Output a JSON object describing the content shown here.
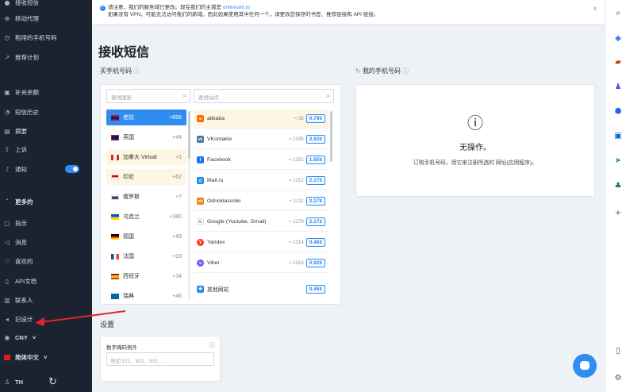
{
  "sidebar": {
    "items": [
      {
        "icon": "user-icon",
        "label": "接收短信"
      },
      {
        "icon": "proxy-icon",
        "label": "移动代理"
      },
      {
        "icon": "rent-icon",
        "label": "租用的手机号码"
      },
      {
        "icon": "referral-icon",
        "label": "推荐计划"
      },
      {
        "icon": "wallet-icon",
        "label": "补充余额"
      },
      {
        "icon": "history-icon",
        "label": "短信历史"
      },
      {
        "icon": "doc-icon",
        "label": "摘要"
      },
      {
        "icon": "upload-icon",
        "label": "上诉"
      },
      {
        "icon": "bell-icon",
        "label": "通知"
      },
      {
        "icon": "chevron-up-icon",
        "label": "更多的"
      },
      {
        "icon": "hint-icon",
        "label": "指示"
      },
      {
        "icon": "message-icon",
        "label": "消息"
      },
      {
        "icon": "heart-icon",
        "label": "喜欢的"
      },
      {
        "icon": "api-icon",
        "label": "API文档"
      },
      {
        "icon": "contacts-icon",
        "label": "联系人"
      },
      {
        "icon": "arrow-left-icon",
        "label": "旧设计"
      }
    ],
    "currency": "CNY",
    "language": "简体中文",
    "user_initials": "TH"
  },
  "notice": {
    "line1_prefix": "请注意，我们的服务域已更改。现在我们的主域是",
    "domain": "onlinesim.io",
    "line2": "如果没有 VPN，可能无法访问我们的新域。因此如果使用其中任何一个，请更改您保存的书签、推荐链接和 API 链接。",
    "close": "x"
  },
  "main": {
    "title": "接收短信",
    "buy_label": "买手机号码",
    "my_numbers_label": "我的手机号码",
    "country_search_placeholder": "查找国家",
    "service_search_placeholder": "查找站点",
    "empty_title": "无操作。",
    "empty_text": "订购手机号码，用它来注册所选的 网址(应用程序)。",
    "settings_label": "设置",
    "exclude_label": "数字掩码例外",
    "exclude_placeholder": "例如 911、902、932、..."
  },
  "countries": [
    {
      "name": "老挝",
      "count": "+856"
    },
    {
      "name": "英国",
      "count": "+44"
    },
    {
      "name": "加拿大 Virtual",
      "count": "+1"
    },
    {
      "name": "印尼",
      "count": "+62"
    },
    {
      "name": "俄罗斯",
      "count": "+7"
    },
    {
      "name": "乌克兰",
      "count": "+380"
    },
    {
      "name": "德国",
      "count": "+49"
    },
    {
      "name": "法国",
      "count": "+33"
    },
    {
      "name": "西班牙",
      "count": "+34"
    },
    {
      "name": "瑞典",
      "count": "+46"
    }
  ],
  "services": [
    {
      "name": "alibaba",
      "num": "≈ 35",
      "price": "0.79¥",
      "logo": "alibaba-icon",
      "color": "#ff6a00"
    },
    {
      "name": "VKontakte",
      "num": "≈ 1335",
      "price": "2.83¥",
      "logo": "vk-icon",
      "color": "#4c75a3"
    },
    {
      "name": "Facebook",
      "num": "≈ 1251",
      "price": "1.65¥",
      "logo": "facebook-icon",
      "color": "#1877f2"
    },
    {
      "name": "Mail.ru",
      "num": "≈ 1212",
      "price": "2.17¥",
      "logo": "mailru-icon",
      "color": "#168de2"
    },
    {
      "name": "Odnoklassniki",
      "num": "≈ 1211",
      "price": "2.17¥",
      "logo": "ok-icon",
      "color": "#ee8208"
    },
    {
      "name": "Google (Youtube, Gmail)",
      "num": "≈ 1279",
      "price": "2.17¥",
      "logo": "google-icon",
      "color": "#4285f4"
    },
    {
      "name": "Yandex",
      "num": "≈ 1214",
      "price": "0.46¥",
      "logo": "yandex-icon",
      "color": "#fc3f1d"
    },
    {
      "name": "Viber",
      "num": "≈ 1316",
      "price": "0.92¥",
      "logo": "viber-icon",
      "color": "#7360f2"
    },
    {
      "name": "其他网站",
      "num": "",
      "price": "0.46¥",
      "logo": "other-icon",
      "color": "#2f8cf0"
    }
  ]
}
